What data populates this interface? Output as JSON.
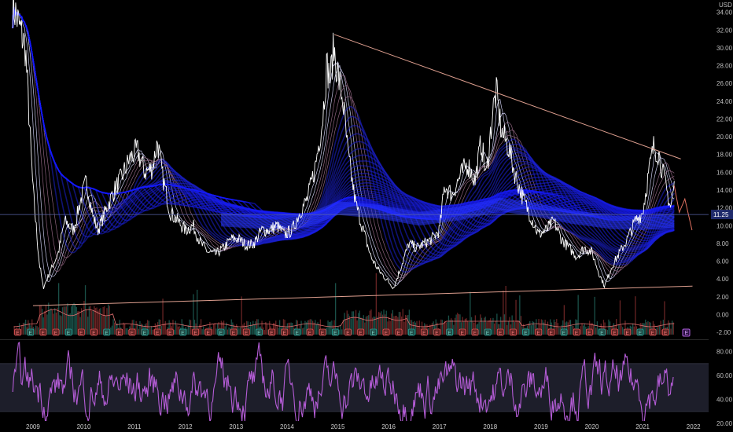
{
  "currency": "USD",
  "price_label": "11.25",
  "earnings_badge": "E",
  "chart_data": [
    {
      "type": "line",
      "name": "price",
      "x_ticks": [
        "2009",
        "2010",
        "2011",
        "2012",
        "2013",
        "2014",
        "2015",
        "2016",
        "2017",
        "2018",
        "2019",
        "2020",
        "2021",
        "2022"
      ],
      "y_ticks": [
        "34.00",
        "32.00",
        "30.00",
        "28.00",
        "26.00",
        "24.00",
        "22.00",
        "20.00",
        "18.00",
        "16.00",
        "14.00",
        "12.00",
        "10.00",
        "8.00",
        "6.00",
        "4.00",
        "2.00",
        "0.00",
        "-2.00"
      ],
      "ylim": [
        -2,
        35
      ],
      "xlim": [
        2009.0,
        2022.2
      ],
      "last_price": 11.25,
      "keypoints": [
        [
          2008.6,
          35.0
        ],
        [
          2008.85,
          30.0
        ],
        [
          2009.0,
          14.0
        ],
        [
          2009.12,
          6.0
        ],
        [
          2009.2,
          3.0
        ],
        [
          2009.35,
          5.0
        ],
        [
          2009.5,
          7.0
        ],
        [
          2009.62,
          10.5
        ],
        [
          2009.8,
          9.5
        ],
        [
          2009.92,
          12.5
        ],
        [
          2010.05,
          15.0
        ],
        [
          2010.18,
          11.0
        ],
        [
          2010.28,
          9.5
        ],
        [
          2010.45,
          12.0
        ],
        [
          2010.6,
          14.0
        ],
        [
          2010.75,
          15.5
        ],
        [
          2010.9,
          17.5
        ],
        [
          2011.05,
          18.5
        ],
        [
          2011.2,
          16.0
        ],
        [
          2011.35,
          16.5
        ],
        [
          2011.45,
          19.5
        ],
        [
          2011.55,
          15.5
        ],
        [
          2011.7,
          11.5
        ],
        [
          2011.85,
          10.5
        ],
        [
          2012.0,
          9.5
        ],
        [
          2012.15,
          10.0
        ],
        [
          2012.3,
          8.0
        ],
        [
          2012.45,
          7.0
        ],
        [
          2012.6,
          6.8
        ],
        [
          2012.75,
          7.5
        ],
        [
          2012.9,
          8.5
        ],
        [
          2013.05,
          8.5
        ],
        [
          2013.2,
          7.8
        ],
        [
          2013.35,
          8.0
        ],
        [
          2013.5,
          9.5
        ],
        [
          2013.65,
          9.5
        ],
        [
          2013.8,
          10.0
        ],
        [
          2013.95,
          9.0
        ],
        [
          2014.1,
          9.5
        ],
        [
          2014.25,
          11.5
        ],
        [
          2014.4,
          13.0
        ],
        [
          2014.55,
          16.5
        ],
        [
          2014.7,
          22.0
        ],
        [
          2014.78,
          28.0
        ],
        [
          2014.85,
          26.5
        ],
        [
          2014.92,
          30.0
        ],
        [
          2015.0,
          27.0
        ],
        [
          2015.1,
          24.0
        ],
        [
          2015.2,
          18.0
        ],
        [
          2015.35,
          12.5
        ],
        [
          2015.5,
          9.5
        ],
        [
          2015.65,
          6.5
        ],
        [
          2015.8,
          5.0
        ],
        [
          2015.95,
          4.0
        ],
        [
          2016.1,
          3.0
        ],
        [
          2016.25,
          5.5
        ],
        [
          2016.4,
          8.0
        ],
        [
          2016.55,
          7.5
        ],
        [
          2016.7,
          8.0
        ],
        [
          2016.85,
          8.5
        ],
        [
          2017.0,
          9.5
        ],
        [
          2017.1,
          14.5
        ],
        [
          2017.25,
          13.5
        ],
        [
          2017.4,
          15.5
        ],
        [
          2017.55,
          17.0
        ],
        [
          2017.7,
          15.0
        ],
        [
          2017.82,
          19.5
        ],
        [
          2017.92,
          15.5
        ],
        [
          2018.05,
          23.0
        ],
        [
          2018.12,
          25.0
        ],
        [
          2018.22,
          20.5
        ],
        [
          2018.35,
          19.0
        ],
        [
          2018.5,
          15.5
        ],
        [
          2018.65,
          13.0
        ],
        [
          2018.8,
          11.0
        ],
        [
          2018.95,
          9.0
        ],
        [
          2019.1,
          9.5
        ],
        [
          2019.25,
          10.5
        ],
        [
          2019.4,
          8.5
        ],
        [
          2019.55,
          7.5
        ],
        [
          2019.7,
          6.5
        ],
        [
          2019.85,
          7.5
        ],
        [
          2020.0,
          7.0
        ],
        [
          2020.15,
          4.5
        ],
        [
          2020.25,
          3.2
        ],
        [
          2020.4,
          5.5
        ],
        [
          2020.55,
          7.0
        ],
        [
          2020.7,
          8.5
        ],
        [
          2020.85,
          10.5
        ],
        [
          2021.0,
          11.5
        ],
        [
          2021.12,
          16.0
        ],
        [
          2021.22,
          19.0
        ],
        [
          2021.32,
          18.0
        ],
        [
          2021.45,
          14.5
        ],
        [
          2021.55,
          12.0
        ],
        [
          2021.62,
          14.5
        ]
      ]
    },
    {
      "type": "line",
      "name": "indicator",
      "y_ticks": [
        "80.00",
        "60.00",
        "40.00",
        "20.00"
      ],
      "ylim": [
        15,
        90
      ],
      "bands": [
        30,
        70
      ]
    }
  ]
}
